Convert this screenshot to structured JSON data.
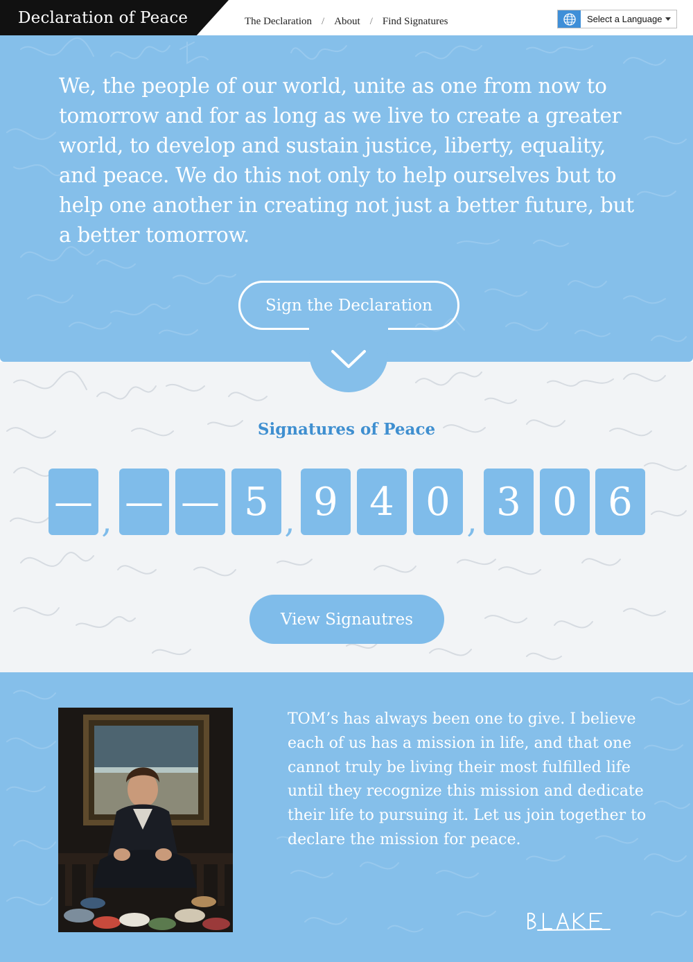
{
  "header": {
    "brand": "Declaration of Peace",
    "nav": [
      {
        "label": "The Declaration"
      },
      {
        "label": "About"
      },
      {
        "label": "Find Signatures"
      }
    ],
    "nav_separator": "/",
    "language_select": {
      "value": "Select a Language",
      "icon": "globe-icon"
    }
  },
  "hero": {
    "declaration_text": "We, the people of our world, unite as one from now to tomorrow and for as long as we live to create a greater world, to develop and sustain justice, liberty, equality, and peace. We do this not only to help ourselves but to help one another in creating not just a better future, but a better tomorrow.",
    "sign_button": "Sign the Declaration",
    "scroll_icon": "chevron-down-icon"
  },
  "signatures": {
    "title": "Signatures of Peace",
    "digits": [
      "—",
      "—",
      "—",
      "5",
      "9",
      "4",
      "0",
      "3",
      "0",
      "6"
    ],
    "comma": ",",
    "view_button": "View Signautres"
  },
  "founder": {
    "quote": "TOM’s has always been one to give. I believe each of us has a mission in life, and that one cannot truly be living their most fulfilled life until they recognize this mission and dedicate their life to pursuing it. Let us join together to declare the mission for peace.",
    "signature": "BLAKE"
  },
  "colors": {
    "accent_blue": "#85bfea",
    "digit_blue": "#7fbcea",
    "title_blue": "#3f8fd0",
    "header_black": "#111111"
  }
}
